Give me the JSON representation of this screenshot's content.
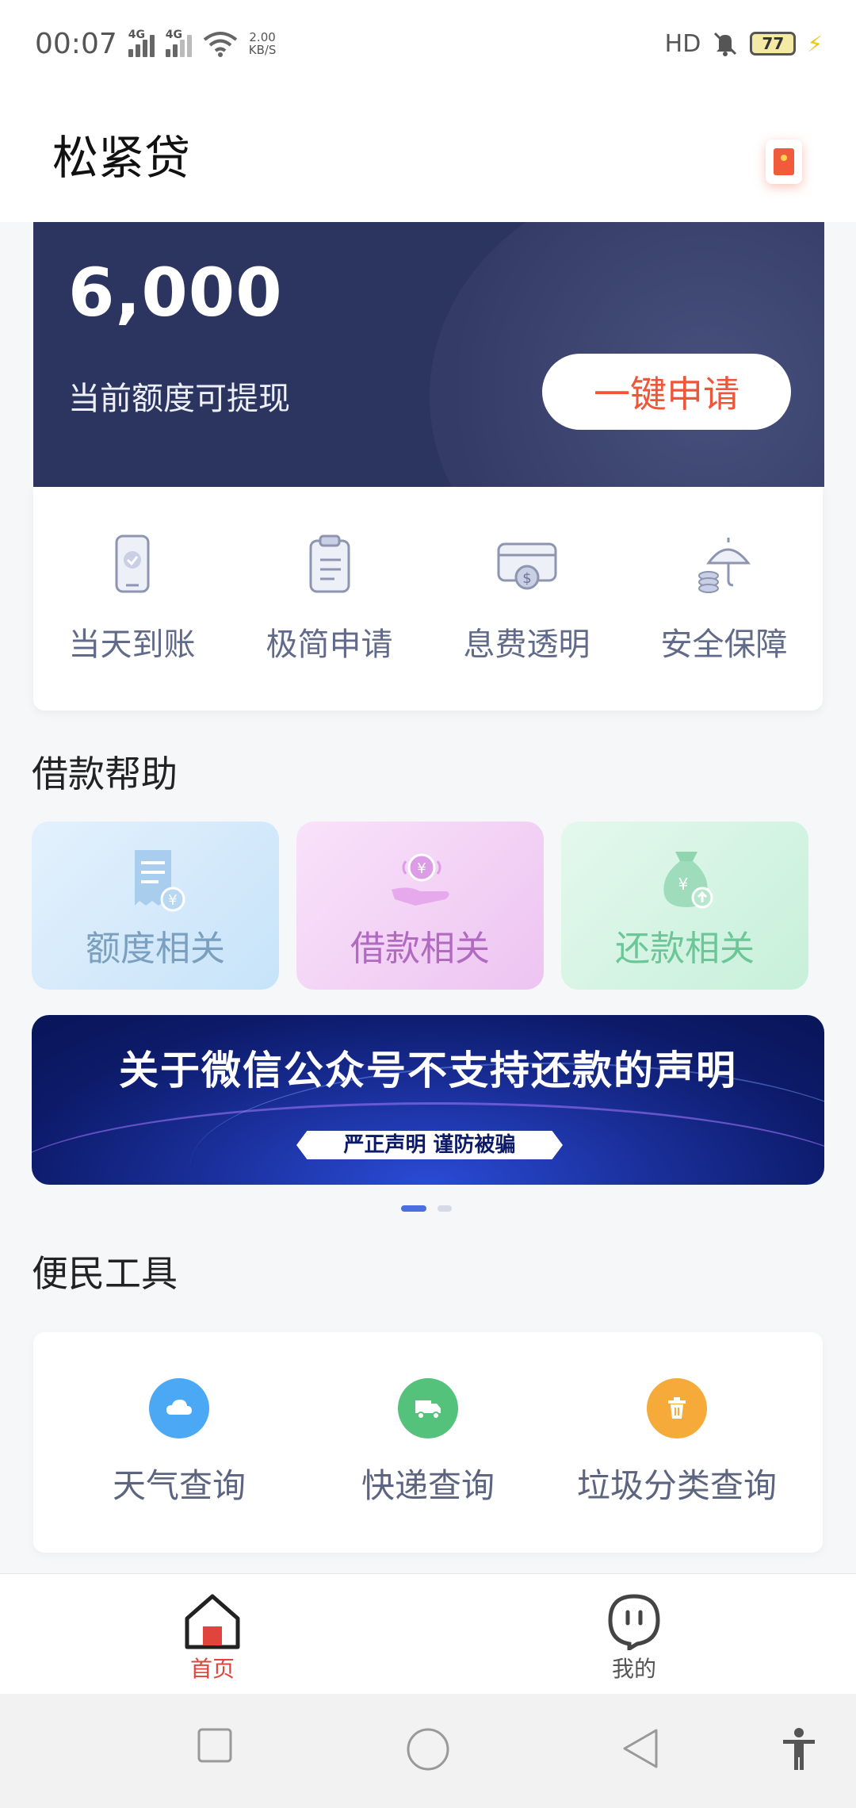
{
  "status_bar": {
    "time": "00:07",
    "network1": "4G",
    "network2": "4G",
    "speed_value": "2.00",
    "speed_unit": "KB/S",
    "hd": "HD",
    "battery": "77"
  },
  "header": {
    "title": "松紧贷"
  },
  "hero": {
    "amount": "6,000",
    "subtitle": "当前额度可提现",
    "apply_label": "一键申请"
  },
  "features": [
    {
      "label": "当天到账",
      "icon": "phone-check-icon"
    },
    {
      "label": "极简申请",
      "icon": "clipboard-icon"
    },
    {
      "label": "息费透明",
      "icon": "card-dollar-icon"
    },
    {
      "label": "安全保障",
      "icon": "umbrella-coins-icon"
    }
  ],
  "help_section": {
    "title": "借款帮助",
    "cards": [
      {
        "label": "额度相关",
        "icon": "receipt-yen-icon"
      },
      {
        "label": "借款相关",
        "icon": "hand-coin-icon"
      },
      {
        "label": "还款相关",
        "icon": "money-bag-icon"
      }
    ]
  },
  "banner": {
    "title": "关于微信公众号不支持还款的声明",
    "tag": "严正声明  谨防被骗"
  },
  "tools_section": {
    "title": "便民工具",
    "items": [
      {
        "label": "天气查询",
        "icon": "cloud-icon",
        "color": "#4aa8f5"
      },
      {
        "label": "快递查询",
        "icon": "truck-icon",
        "color": "#54c27a"
      },
      {
        "label": "垃圾分类查询",
        "icon": "trash-icon",
        "color": "#f5aa3a"
      }
    ]
  },
  "tabbar": {
    "home": "首页",
    "mine": "我的",
    "active_color": "#e0443a"
  }
}
